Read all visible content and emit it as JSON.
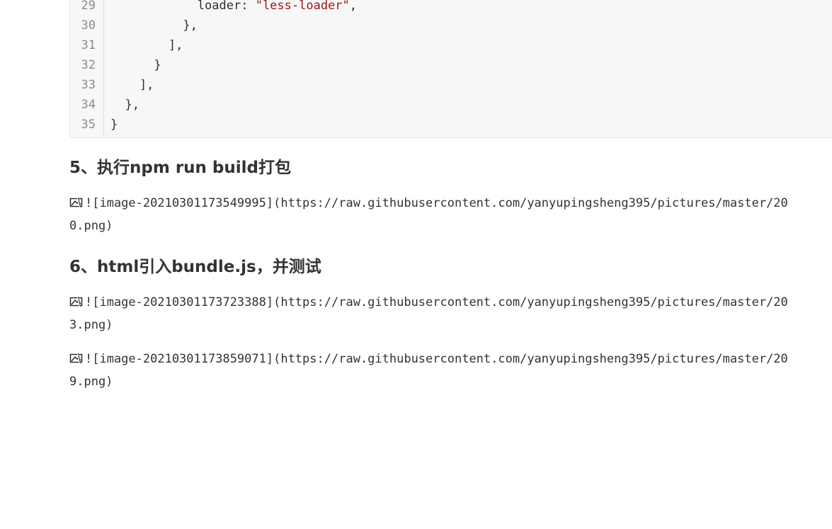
{
  "code": {
    "lines": [
      {
        "num": "29",
        "pre": "            loader: ",
        "str": "\"less-loader\"",
        "post": ","
      },
      {
        "num": "30",
        "pre": "          },",
        "str": "",
        "post": ""
      },
      {
        "num": "31",
        "pre": "        ],",
        "str": "",
        "post": ""
      },
      {
        "num": "32",
        "pre": "      }",
        "str": "",
        "post": ""
      },
      {
        "num": "33",
        "pre": "    ],",
        "str": "",
        "post": ""
      },
      {
        "num": "34",
        "pre": "  },",
        "str": "",
        "post": ""
      },
      {
        "num": "35",
        "pre": "}",
        "str": "",
        "post": ""
      }
    ],
    "colors": {
      "string": "#a31515",
      "text": "#2f2f33",
      "gutter": "#8b8b8f",
      "background": "#f7f7f8"
    }
  },
  "sections": {
    "step5": {
      "heading": "5、执行npm run build打包",
      "images": [
        {
          "line1": "![image-20210301173549995](https://raw.githubusercontent.com/yanyupingsheng395/pictures/master/20",
          "line2": "0.png)"
        }
      ]
    },
    "step6": {
      "heading": "6、html引入bundle.js，并测试",
      "images": [
        {
          "line1": "![image-20210301173723388](https://raw.githubusercontent.com/yanyupingsheng395/pictures/master/20",
          "line2": "3.png)"
        },
        {
          "line1": "![image-20210301173859071](https://raw.githubusercontent.com/yanyupingsheng395/pictures/master/20",
          "line2": "9.png)"
        }
      ]
    }
  },
  "icons": {
    "broken_image": "broken-image-icon"
  }
}
